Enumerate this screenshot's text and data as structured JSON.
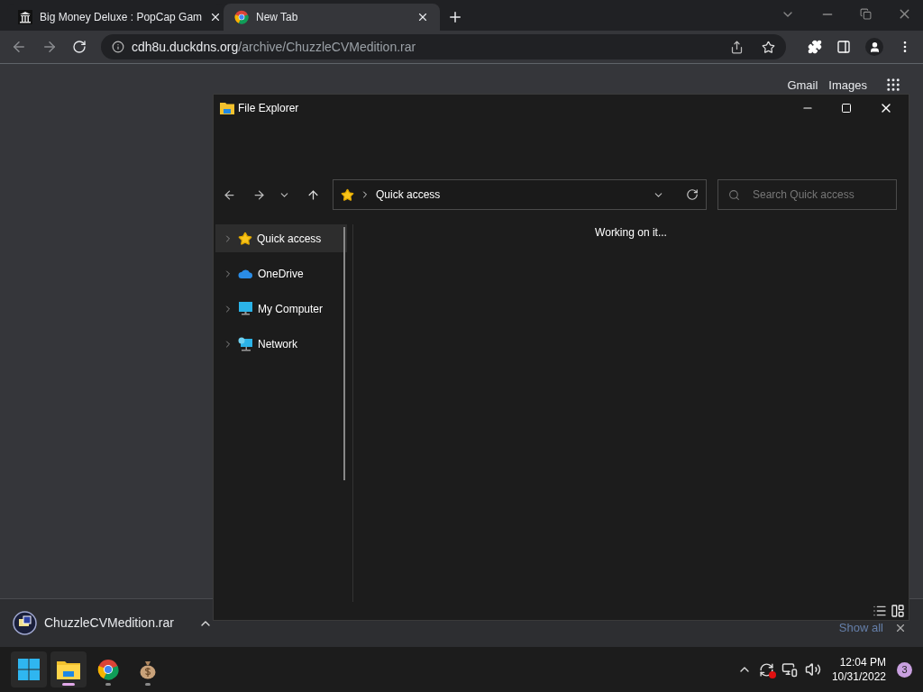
{
  "browser": {
    "tabs": [
      {
        "title": "Big Money Deluxe : PopCap Gam",
        "kind": "museum",
        "selected": false
      },
      {
        "title": "New Tab",
        "kind": "chrome",
        "selected": true
      }
    ],
    "address": {
      "host": "cdh8u.duckdns.org",
      "path": "/archive/ChuzzleCVMedition.rar"
    },
    "page_links": [
      "Gmail",
      "Images"
    ],
    "download": {
      "filename": "ChuzzleCVMedition.rar",
      "show_all": "Show all"
    }
  },
  "explorer": {
    "title": "File Explorer",
    "location": "Quick access",
    "search": {
      "placeholder": "Search Quick access"
    },
    "nav": [
      {
        "label": "Quick access",
        "kind": "star",
        "selected": true
      },
      {
        "label": "OneDrive",
        "kind": "cloud",
        "selected": false
      },
      {
        "label": "My Computer",
        "kind": "monitor",
        "selected": false
      },
      {
        "label": "Network",
        "kind": "network",
        "selected": false
      }
    ],
    "status": "Working on it..."
  },
  "taskbar": {
    "apps": [
      {
        "kind": "start",
        "active": true,
        "running": false
      },
      {
        "kind": "folder",
        "active": true,
        "running": true
      },
      {
        "kind": "chrome",
        "active": false,
        "running": true
      },
      {
        "kind": "moneybag",
        "active": false,
        "running": true
      }
    ],
    "time": "12:04 PM",
    "date": "10/31/2022",
    "notifications": "3"
  }
}
